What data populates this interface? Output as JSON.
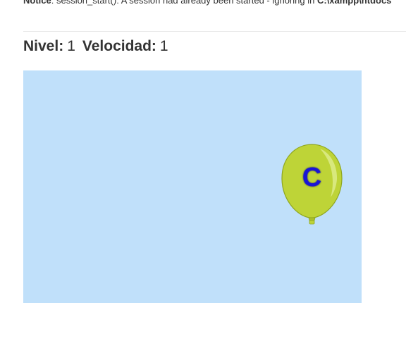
{
  "notice": {
    "label": "Notice",
    "message": ": session_start(): A session had already been started - ignoring in ",
    "path": "C:\\xampp\\htdocs"
  },
  "status": {
    "level_label": "Nivel:",
    "level_value": "1",
    "speed_label": "Velocidad:",
    "speed_value": "1"
  },
  "game": {
    "background_color": "#c0e0fa",
    "balloons": [
      {
        "letter": "C",
        "color": "#bed437",
        "letter_color": "#1a15d6"
      }
    ]
  }
}
